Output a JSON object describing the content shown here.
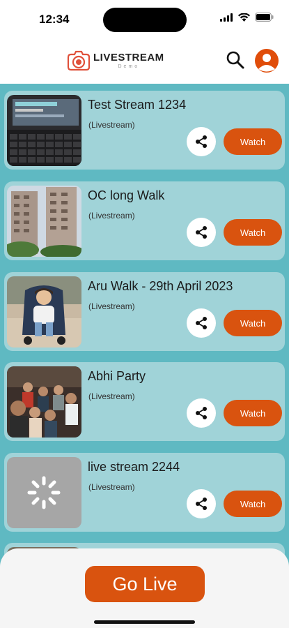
{
  "status_bar": {
    "time": "12:34"
  },
  "header": {
    "logo_title": "LIVESTREAM",
    "logo_subtitle": "Demo",
    "accent_color": "#d9530f"
  },
  "streams": [
    {
      "title": "Test Stream 1234",
      "type": "(Livestream)",
      "share_icon": "share-icon",
      "watch_label": "Watch",
      "thumbnail": "keyboard-laptop-photo"
    },
    {
      "title": "OC long Walk",
      "type": "(Livestream)",
      "share_icon": "share-icon",
      "watch_label": "Watch",
      "thumbnail": "apartment-buildings-photo"
    },
    {
      "title": "Aru Walk - 29th April 2023",
      "type": "(Livestream)",
      "share_icon": "share-icon",
      "watch_label": "Watch",
      "thumbnail": "child-in-stroller-photo"
    },
    {
      "title": "Abhi Party",
      "type": "(Livestream)",
      "share_icon": "share-icon",
      "watch_label": "Watch",
      "thumbnail": "group-selfie-photo"
    },
    {
      "title": "live stream 2244",
      "type": "(Livestream)",
      "share_icon": "share-icon",
      "watch_label": "Watch",
      "thumbnail": "loading-spinner-placeholder"
    }
  ],
  "bottom": {
    "go_live_label": "Go Live"
  }
}
